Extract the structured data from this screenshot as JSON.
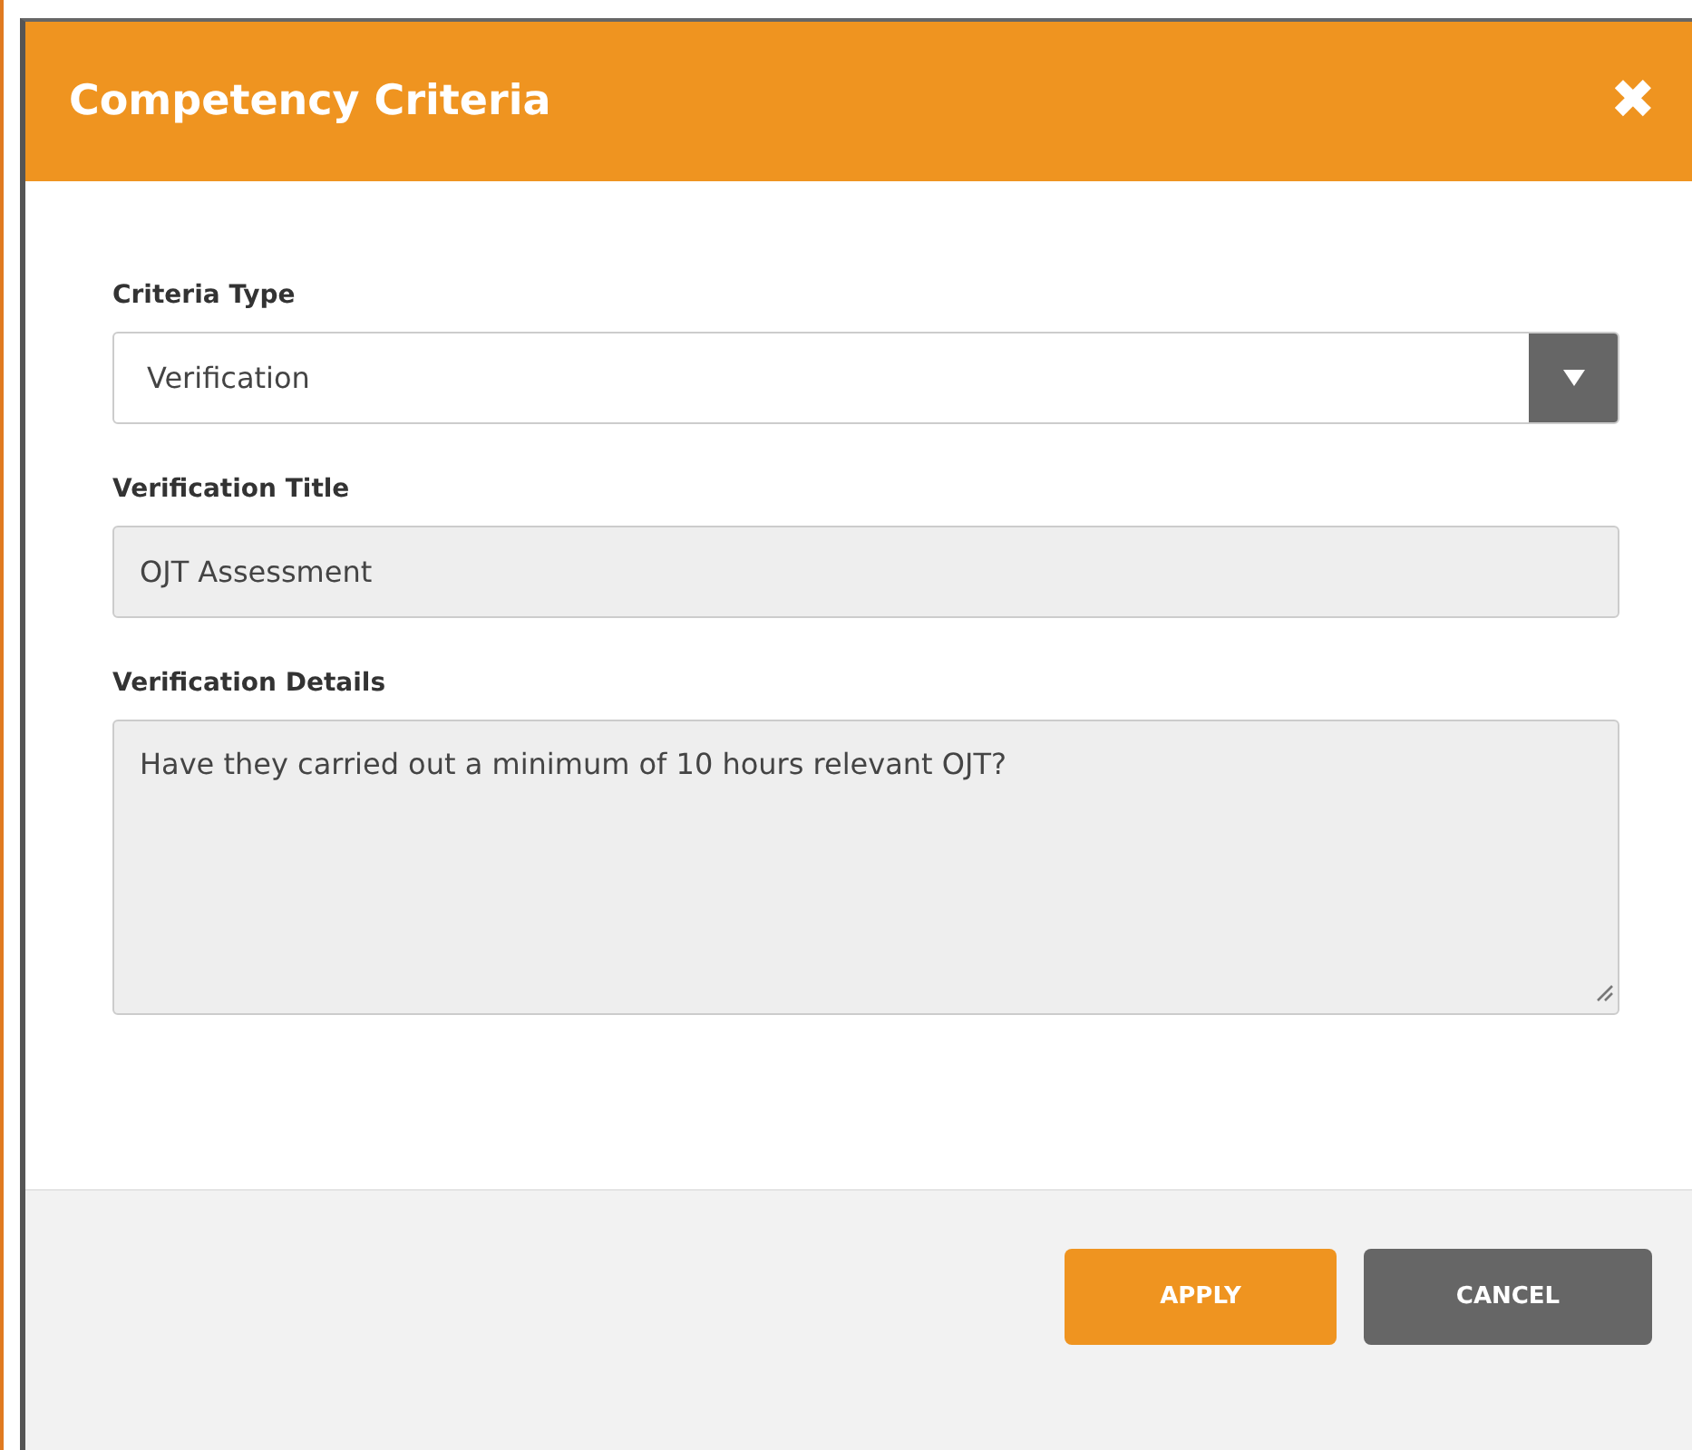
{
  "dialog": {
    "title": "Competency Criteria",
    "close_icon": "✖"
  },
  "fields": [
    {
      "kind": "select",
      "label": "Criteria Type",
      "value": "Verification",
      "disabled": false
    },
    {
      "kind": "text",
      "label": "Verification Title",
      "value": "OJT Assessment",
      "disabled": true
    },
    {
      "kind": "textarea",
      "label": "Verification Details",
      "value": "Have they carried out a minimum of 10 hours relevant OJT?",
      "disabled": true
    }
  ],
  "buttons": [
    {
      "label": "APPLY",
      "kind": "primary"
    },
    {
      "label": "CANCEL",
      "kind": "secondary"
    }
  ]
}
